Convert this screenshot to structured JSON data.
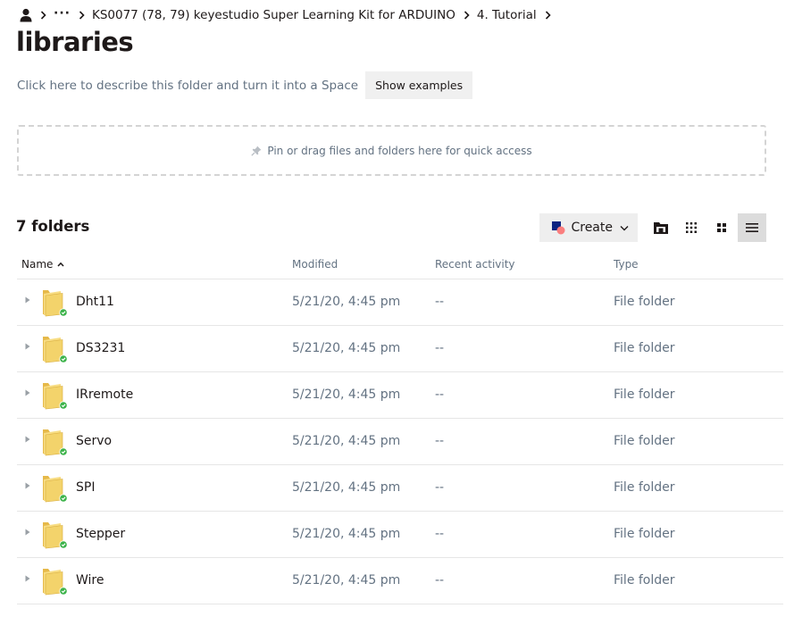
{
  "breadcrumb": {
    "icon": "person-icon",
    "more": "···",
    "items": [
      "KS0077 (78, 79) keyestudio Super Learning Kit for ARDUINO",
      "4. Tutorial"
    ]
  },
  "page": {
    "title": "libraries",
    "describe_text": "Click here to describe this folder and turn it into a Space",
    "show_examples_label": "Show examples",
    "pin_text": "Pin or drag files and folders here for quick access"
  },
  "toolbar": {
    "folder_count": "7 folders",
    "create_label": "Create",
    "view_buttons": [
      "new-folder-icon",
      "grid-small-icon",
      "grid-large-icon",
      "list-view-icon"
    ],
    "active_view": "list-view-icon"
  },
  "table": {
    "columns": {
      "name": "Name",
      "modified": "Modified",
      "activity": "Recent activity",
      "type": "Type"
    },
    "sort": "ascending",
    "rows": [
      {
        "name": "Dht11",
        "modified": "5/21/20, 4:45 pm",
        "activity": "--",
        "type": "File folder"
      },
      {
        "name": "DS3231",
        "modified": "5/21/20, 4:45 pm",
        "activity": "--",
        "type": "File folder"
      },
      {
        "name": "IRremote",
        "modified": "5/21/20, 4:45 pm",
        "activity": "--",
        "type": "File folder"
      },
      {
        "name": "Servo",
        "modified": "5/21/20, 4:45 pm",
        "activity": "--",
        "type": "File folder"
      },
      {
        "name": "SPI",
        "modified": "5/21/20, 4:45 pm",
        "activity": "--",
        "type": "File folder"
      },
      {
        "name": "Stepper",
        "modified": "5/21/20, 4:45 pm",
        "activity": "--",
        "type": "File folder"
      },
      {
        "name": "Wire",
        "modified": "5/21/20, 4:45 pm",
        "activity": "--",
        "type": "File folder"
      }
    ]
  },
  "colors": {
    "text": "#1e1919",
    "muted": "#637282",
    "folder": "#f3d36b",
    "sync_badge": "#3cb34a",
    "create_blue": "#0d2481",
    "create_pink": "#fa7e7e"
  }
}
